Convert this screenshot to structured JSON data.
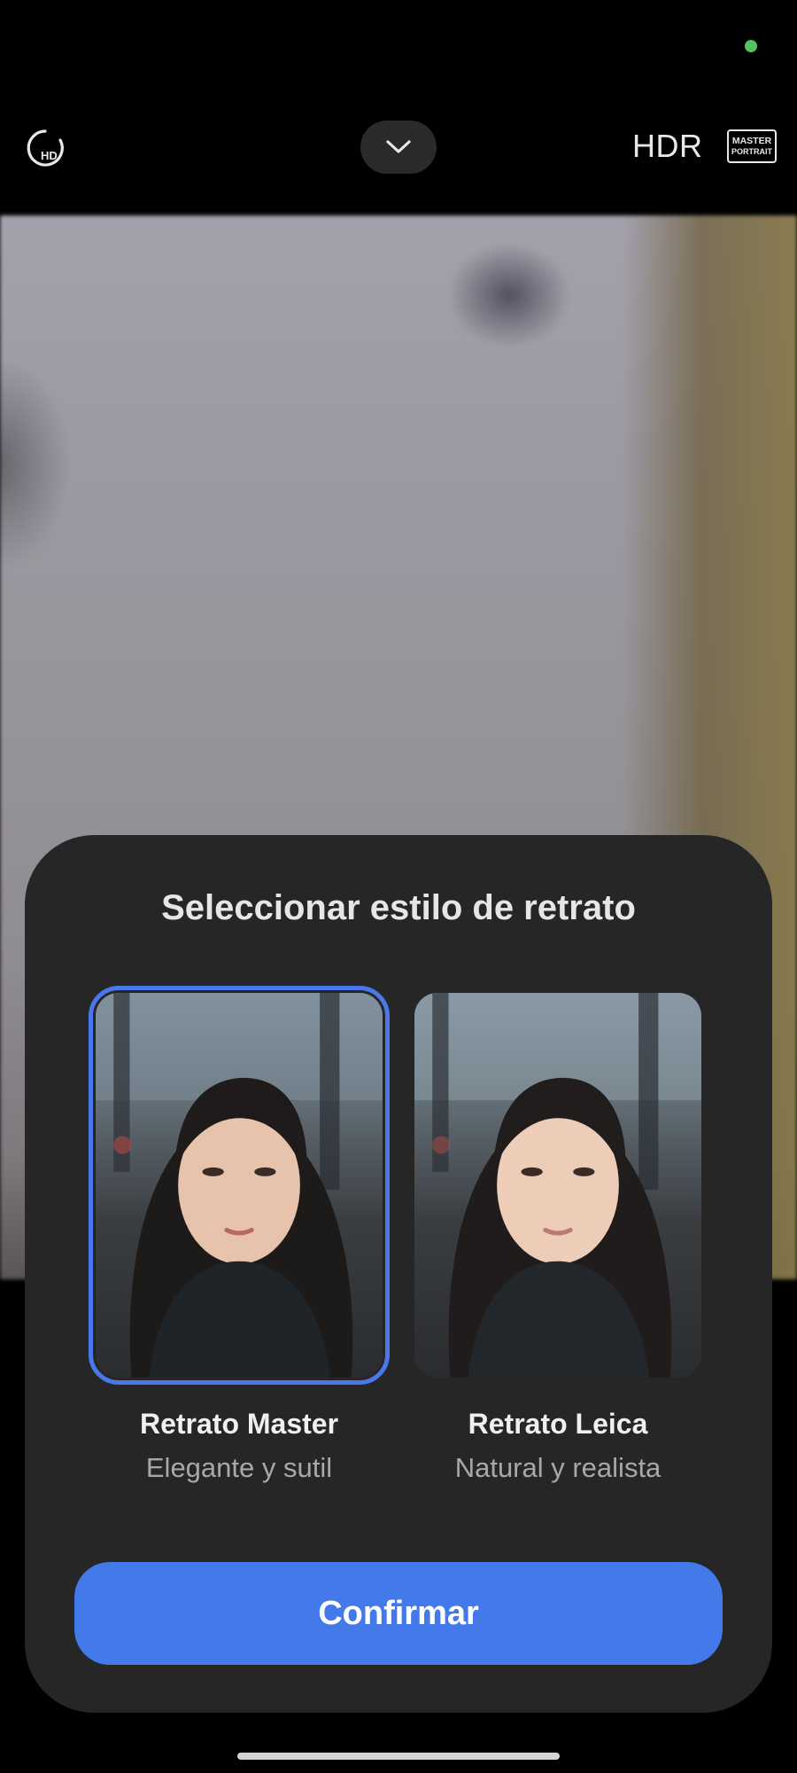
{
  "status_bar": {
    "indicator_color": "#53c25f"
  },
  "top_bar": {
    "hd_icon": "hd-refresh-icon",
    "hd_label": "HD",
    "chevron_icon": "chevron-down-icon",
    "hdr_label": "HDR",
    "mode_badge": {
      "line1": "MASTER",
      "line2": "PORTRAIT"
    }
  },
  "style_sheet": {
    "title": "Seleccionar estilo de retrato",
    "options": [
      {
        "title": "Retrato Master",
        "subtitle": "Elegante y sutil",
        "selected": true
      },
      {
        "title": "Retrato Leica",
        "subtitle": "Natural y realista",
        "selected": false
      }
    ],
    "confirm_label": "Confirmar"
  },
  "colors": {
    "accent": "#4479ea",
    "selection_border": "#4a78ec",
    "sheet_background": "#262626"
  }
}
